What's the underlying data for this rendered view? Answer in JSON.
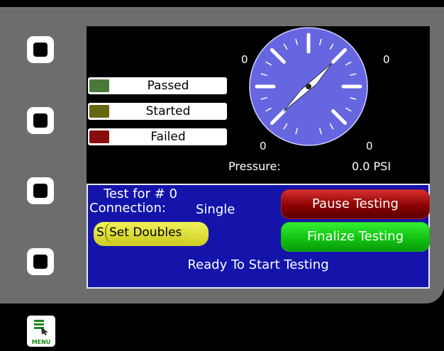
{
  "legend": {
    "passed": {
      "label": "Passed",
      "color": "#4a7a3a"
    },
    "started": {
      "label": "Started",
      "color": "#666611"
    },
    "failed": {
      "label": "Failed",
      "color": "#8a0d0d"
    }
  },
  "gauge": {
    "face_color": "#6666e0",
    "tick_labels": [
      "0",
      "0",
      "0",
      "0"
    ],
    "pressure_label": "Pressure:",
    "pressure_value": "0.0 PSI"
  },
  "panel": {
    "test_for": "Test for # 0",
    "connection_label": "Connection:",
    "connection_value": "Single",
    "status": "Ready To Start Testing",
    "doubles_behind_text": "S",
    "set_doubles_label": "Set Doubles",
    "pause_label": "Pause Testing",
    "finalize_label": "Finalize Testing"
  },
  "menu": {
    "label": "MENU"
  }
}
